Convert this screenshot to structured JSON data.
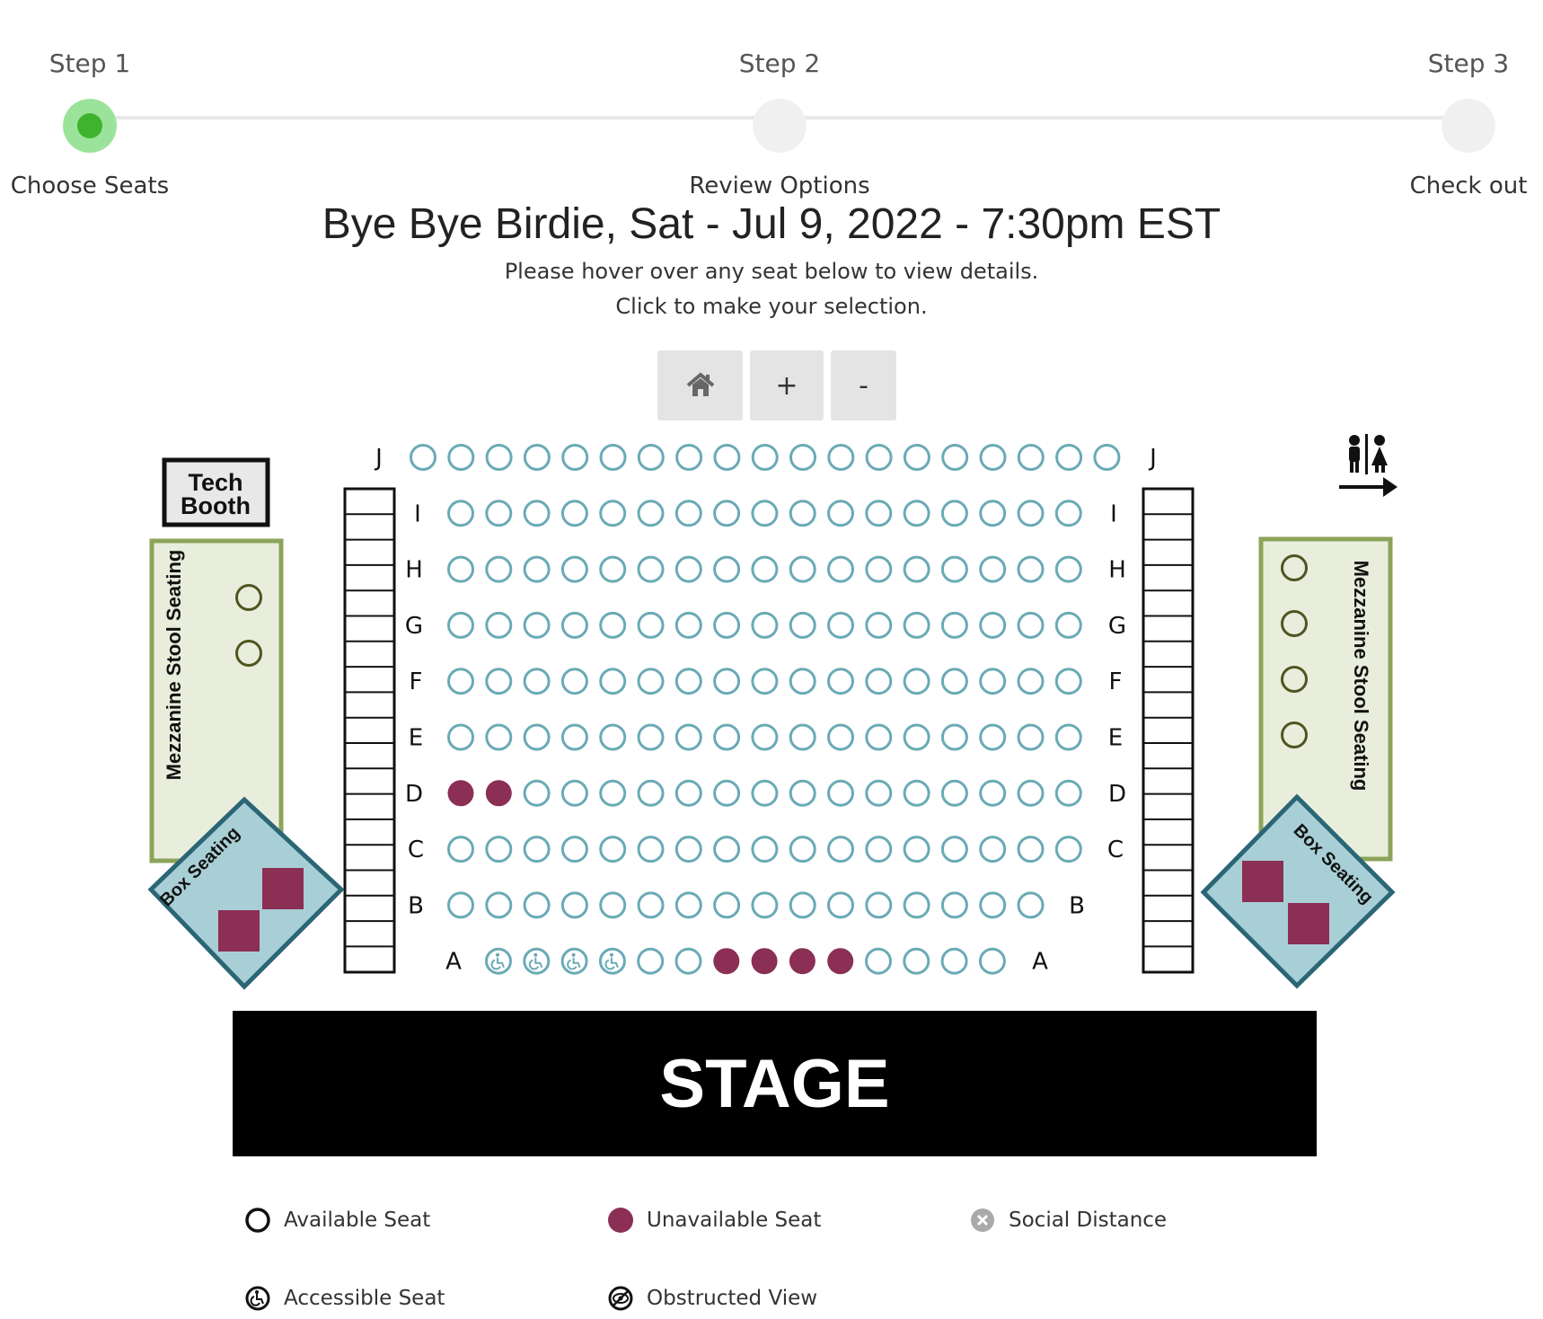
{
  "stepper": {
    "steps": [
      {
        "num": "Step 1",
        "name": "Choose Seats",
        "active": true
      },
      {
        "num": "Step 2",
        "name": "Review Options",
        "active": false
      },
      {
        "num": "Step 3",
        "name": "Check out",
        "active": false
      }
    ]
  },
  "event": {
    "title": "Bye Bye Birdie, Sat - Jul 9, 2022 - 7:30pm EST",
    "instruction_1": "Please hover over any seat below to view details.",
    "instruction_2": "Click to make your selection."
  },
  "zoom_controls": {
    "home_icon": "home-icon",
    "zoom_in": "+",
    "zoom_out": "-"
  },
  "colors": {
    "available": "#6aaab6",
    "unavailable": "#8b2f55",
    "mezzanine_seat": "#4f5520",
    "mezz_border": "#8ca45a",
    "mezz_fill": "#e9eedc",
    "box_border": "#2b6676",
    "box_fill": "#a9cfd6"
  },
  "seating": {
    "rows": [
      {
        "label": "J",
        "seats": [
          "a",
          "a",
          "a",
          "a",
          "a",
          "a",
          "a",
          "a",
          "a",
          "a",
          "a",
          "a",
          "a",
          "a",
          "a",
          "a",
          "a",
          "a",
          "a"
        ]
      },
      {
        "label": "I",
        "seats": [
          "a",
          "a",
          "a",
          "a",
          "a",
          "a",
          "a",
          "a",
          "a",
          "a",
          "a",
          "a",
          "a",
          "a",
          "a",
          "a",
          "a"
        ]
      },
      {
        "label": "H",
        "seats": [
          "a",
          "a",
          "a",
          "a",
          "a",
          "a",
          "a",
          "a",
          "a",
          "a",
          "a",
          "a",
          "a",
          "a",
          "a",
          "a",
          "a"
        ]
      },
      {
        "label": "G",
        "seats": [
          "a",
          "a",
          "a",
          "a",
          "a",
          "a",
          "a",
          "a",
          "a",
          "a",
          "a",
          "a",
          "a",
          "a",
          "a",
          "a",
          "a"
        ]
      },
      {
        "label": "F",
        "seats": [
          "a",
          "a",
          "a",
          "a",
          "a",
          "a",
          "a",
          "a",
          "a",
          "a",
          "a",
          "a",
          "a",
          "a",
          "a",
          "a",
          "a"
        ]
      },
      {
        "label": "E",
        "seats": [
          "a",
          "a",
          "a",
          "a",
          "a",
          "a",
          "a",
          "a",
          "a",
          "a",
          "a",
          "a",
          "a",
          "a",
          "a",
          "a",
          "a"
        ]
      },
      {
        "label": "D",
        "seats": [
          "u",
          "u",
          "a",
          "a",
          "a",
          "a",
          "a",
          "a",
          "a",
          "a",
          "a",
          "a",
          "a",
          "a",
          "a",
          "a",
          "a"
        ]
      },
      {
        "label": "C",
        "seats": [
          "a",
          "a",
          "a",
          "a",
          "a",
          "a",
          "a",
          "a",
          "a",
          "a",
          "a",
          "a",
          "a",
          "a",
          "a",
          "a",
          "a"
        ]
      },
      {
        "label": "B",
        "seats": [
          "a",
          "a",
          "a",
          "a",
          "a",
          "a",
          "a",
          "a",
          "a",
          "a",
          "a",
          "a",
          "a",
          "a",
          "a",
          "a"
        ]
      },
      {
        "label": "A",
        "seats": [
          "w",
          "w",
          "w",
          "w",
          "a",
          "a",
          "u",
          "u",
          "u",
          "u",
          "a",
          "a",
          "a",
          "a"
        ]
      }
    ],
    "tech_booth": "Tech Booth",
    "mezzanine_label": "Mezzanine Stool Seating",
    "mezz_left_seats": 2,
    "mezz_right_seats": 4,
    "box_label": "Box Seating",
    "restroom_icon": "restroom-exit-icon",
    "stage_label": "STAGE"
  },
  "legend": [
    {
      "icon": "available-seat-icon",
      "label": "Available Seat"
    },
    {
      "icon": "unavailable-seat-icon",
      "label": "Unavailable Seat"
    },
    {
      "icon": "social-distance-icon",
      "label": "Social Distance"
    },
    {
      "icon": "accessible-seat-icon",
      "label": "Accessible Seat"
    },
    {
      "icon": "obstructed-view-icon",
      "label": "Obstructed View"
    }
  ]
}
